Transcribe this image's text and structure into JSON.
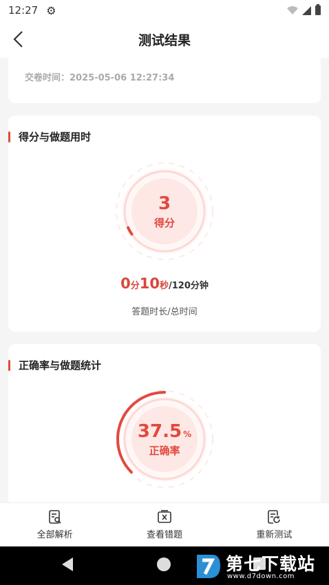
{
  "status_bar": {
    "time": "12:27"
  },
  "nav": {
    "title": "测试结果"
  },
  "submit_info": {
    "label": "交卷时间：",
    "datetime": "2025-05-06 12:27:34"
  },
  "score_section": {
    "title": "得分与做题用时",
    "score_value": "3",
    "score_label": "得分",
    "score_progress": 0.03,
    "time_min": "0",
    "time_min_unit": "分",
    "time_sec": "10",
    "time_sec_unit": "秒",
    "time_total": "/120分钟",
    "caption": "答题时长/总时间"
  },
  "accuracy_section": {
    "title": "正确率与做题统计",
    "accuracy_value": "37.5",
    "accuracy_unit": "%",
    "accuracy_label": "正确率",
    "accuracy_fraction": 0.375
  },
  "bottom_actions": [
    {
      "label": "全部解析",
      "icon": "analysis-icon"
    },
    {
      "label": "查看错题",
      "icon": "wrong-questions-icon"
    },
    {
      "label": "重新测试",
      "icon": "retest-icon"
    }
  ],
  "watermark": {
    "brand": "第七下载站",
    "url": "www.d7down.com"
  },
  "colors": {
    "accent": "#e14a3d",
    "ring_light": "#fde8e6",
    "track": "#fbd3cf"
  }
}
